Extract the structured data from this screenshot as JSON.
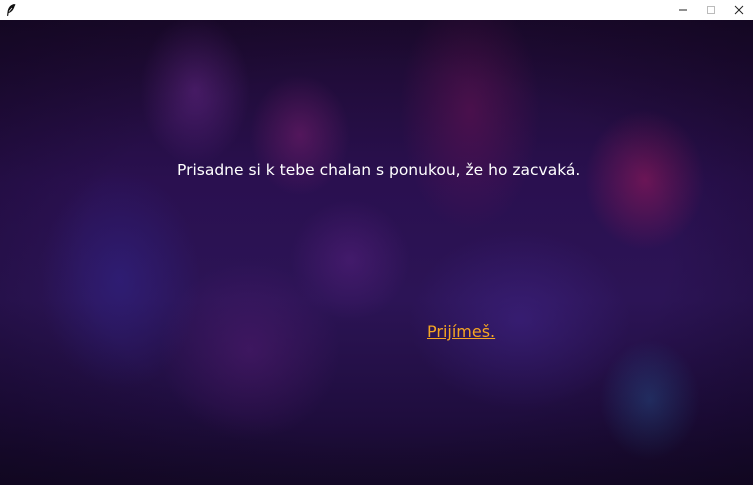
{
  "titlebar": {
    "app_icon": "quill-icon",
    "controls": {
      "minimize_icon": "minimize-icon",
      "maximize_icon": "maximize-icon",
      "close_icon": "close-icon"
    }
  },
  "scene": {
    "story_text": "Prisadne si k tebe chalan s ponukou, že ho zacvaká.",
    "choices": [
      {
        "label": "Prijímeš.",
        "color": "#f5a623"
      }
    ]
  }
}
